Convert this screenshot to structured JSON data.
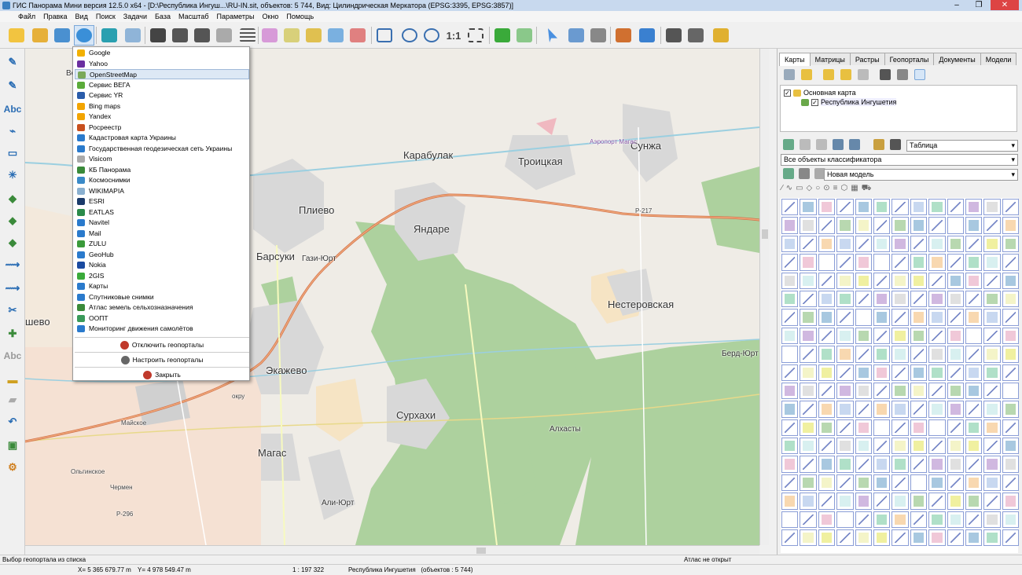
{
  "window": {
    "title": "ГИС Панорама Мини версия 12.5.0 x64 - [D:\\Республика Ингуш...\\RU-IN.sit, объектов: 5 744, Вид: Цилиндрическая Меркатора (EPSG:3395, EPSG:3857)]",
    "minimize": "–",
    "restore": "❐",
    "close": "✕"
  },
  "menu": [
    "Файл",
    "Правка",
    "Вид",
    "Поиск",
    "Задачи",
    "База",
    "Масштаб",
    "Параметры",
    "Окно",
    "Помощь"
  ],
  "toolbar": {
    "scale_label": "1:1"
  },
  "geoportal_menu": {
    "items": [
      {
        "label": "Google",
        "color": "#f2b000"
      },
      {
        "label": "Yahoo",
        "color": "#6b2fa0"
      },
      {
        "label": "OpenStreetMap",
        "color": "#7aa95a",
        "highlighted": true
      },
      {
        "label": "Сервис ВЕГА",
        "color": "#5bab3a"
      },
      {
        "label": "Сервис YR",
        "color": "#2a5caa"
      },
      {
        "label": "Bing maps",
        "color": "#f2a400"
      },
      {
        "label": "Yandex",
        "color": "#f2a400"
      },
      {
        "label": "Росреестр",
        "color": "#c8501e"
      },
      {
        "label": "Кадастровая карта Украины",
        "color": "#2a7acc"
      },
      {
        "label": "Государственная геодезическая сеть Украины",
        "color": "#2a7acc"
      },
      {
        "label": "Visicom",
        "color": "#aaaaaa"
      },
      {
        "label": "КБ Панорама",
        "color": "#3a8a3a"
      },
      {
        "label": "Космоснимки",
        "color": "#3a8ac8"
      },
      {
        "label": "WIKIMAPIA",
        "color": "#8ab0d0"
      },
      {
        "label": "ESRI",
        "color": "#1a3a6a"
      },
      {
        "label": "EATLAS",
        "color": "#2a8a4a"
      },
      {
        "label": "Navitel",
        "color": "#2a7acc"
      },
      {
        "label": "Mail",
        "color": "#2a7acc"
      },
      {
        "label": "ZULU",
        "color": "#3a9a3a"
      },
      {
        "label": "GeoHub",
        "color": "#2a7acc"
      },
      {
        "label": "Nokia",
        "color": "#1a4aa0"
      },
      {
        "label": "2GIS",
        "color": "#3aaa3a"
      },
      {
        "label": "Карты",
        "color": "#2a7acc"
      },
      {
        "label": "Спутниковые снимки",
        "color": "#2a7acc"
      },
      {
        "label": "Атлас земель сельхозназначения",
        "color": "#3a8a3a"
      },
      {
        "label": "ООПТ",
        "color": "#3a9a5a"
      },
      {
        "label": "Мониторинг движения самолётов",
        "color": "#2a7acc"
      }
    ],
    "disable_label": "Отключить геопорталы",
    "configure_label": "Настроить геопорталы",
    "close_label": "Закрыть"
  },
  "map": {
    "places": [
      {
        "name": "Карабулак",
        "size": "lbl"
      },
      {
        "name": "Троицкая",
        "size": "lbl"
      },
      {
        "name": "Сунжа",
        "size": "lbl"
      },
      {
        "name": "Плиево",
        "size": "lbl"
      },
      {
        "name": "Яндаре",
        "size": "lbl"
      },
      {
        "name": "Барсуки",
        "size": "lbl"
      },
      {
        "name": "Гази-Юрт",
        "size": "lbl med"
      },
      {
        "name": "Нестеровская",
        "size": "lbl"
      },
      {
        "name": "Экажево",
        "size": "lbl"
      },
      {
        "name": "Сурхахи",
        "size": "lbl"
      },
      {
        "name": "Алхасты",
        "size": "lbl med"
      },
      {
        "name": "Магас",
        "size": "lbl"
      },
      {
        "name": "Али-Юрт",
        "size": "lbl med"
      },
      {
        "name": "Берд-Юрт",
        "size": "lbl med"
      },
      {
        "name": "шево",
        "size": "lbl"
      },
      {
        "name": "Майское",
        "size": "lbl small"
      },
      {
        "name": "Ольгинское",
        "size": "lbl small"
      },
      {
        "name": "Чермен",
        "size": "lbl small"
      },
      {
        "name": "Аэропорт Магас",
        "size": "lbl small"
      },
      {
        "name": "Р-217",
        "size": "lbl small"
      },
      {
        "name": "Р-296",
        "size": "lbl small"
      },
      {
        "name": "окру",
        "size": "lbl small"
      },
      {
        "name": "Ве",
        "size": "lbl med"
      }
    ]
  },
  "panel": {
    "tabs": [
      "Карты",
      "Матрицы",
      "Растры",
      "Геопорталы",
      "Документы",
      "Модели"
    ],
    "active_tab": "Карты",
    "tree_root": "Основная карта",
    "tree_child": "Республика Ингушетия",
    "view_select": "Таблица",
    "classifier_select": "Все объекты классификатора",
    "model_select": "Новая модель"
  },
  "status": {
    "hint": "Выбор геопортала из списка",
    "atlas": "Атлас не открыт",
    "x": "X= 5 365 679.77 m",
    "y": "Y= 4 978 549.47 m",
    "scale": "1 : 197 322",
    "region": "Республика Ингушетия   (объектов : 5 744)"
  }
}
